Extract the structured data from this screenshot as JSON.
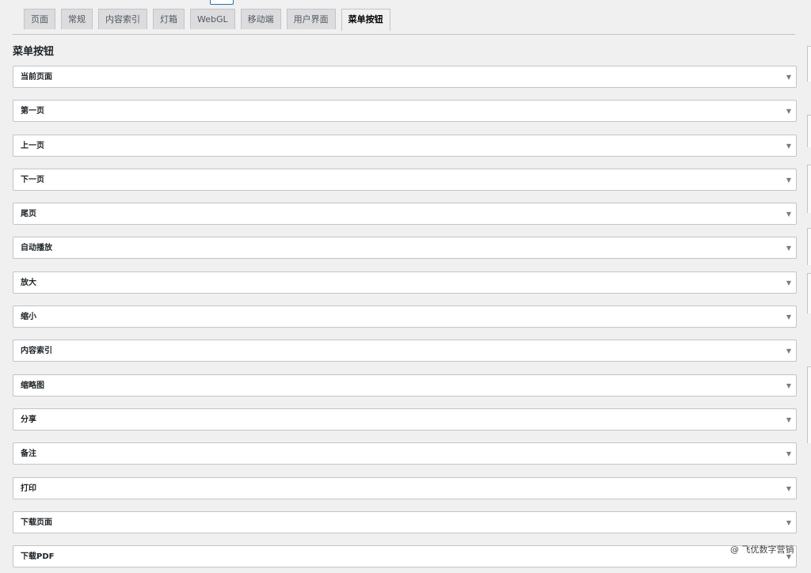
{
  "tabs": [
    {
      "label": "页面",
      "active": false
    },
    {
      "label": "常规",
      "active": false
    },
    {
      "label": "内容索引",
      "active": false
    },
    {
      "label": "灯箱",
      "active": false
    },
    {
      "label": "WebGL",
      "active": false
    },
    {
      "label": "移动端",
      "active": false
    },
    {
      "label": "用户界面",
      "active": false
    },
    {
      "label": "菜单按钮",
      "active": true
    }
  ],
  "section_title": "菜单按钮",
  "menu_items": [
    {
      "label": "当前页面"
    },
    {
      "label": "第一页"
    },
    {
      "label": "上一页"
    },
    {
      "label": "下一页"
    },
    {
      "label": "尾页"
    },
    {
      "label": "自动播放"
    },
    {
      "label": "放大"
    },
    {
      "label": "缩小"
    },
    {
      "label": "内容索引"
    },
    {
      "label": "缩略图"
    },
    {
      "label": "分享"
    },
    {
      "label": "备注"
    },
    {
      "label": "打印"
    },
    {
      "label": "下载页面"
    },
    {
      "label": "下载PDF"
    }
  ],
  "caret_glyph": "▼",
  "watermark": "@ 飞优数字营销"
}
